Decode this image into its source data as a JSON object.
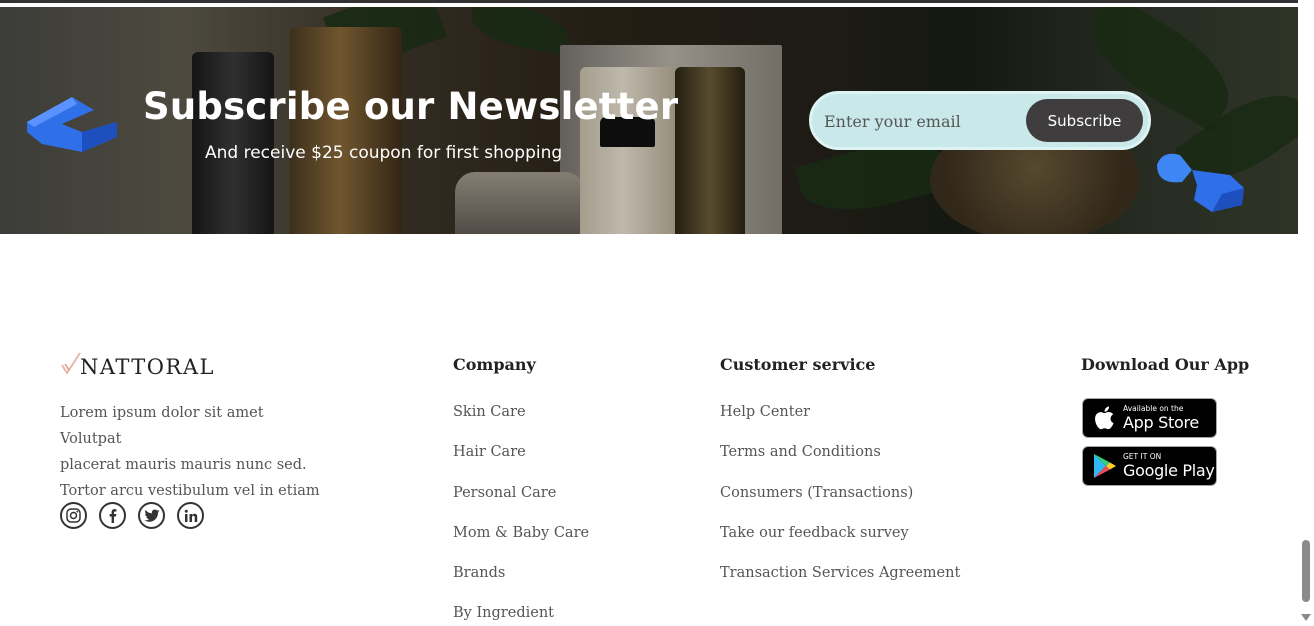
{
  "newsletter": {
    "title": "Subscribe our Newsletter",
    "subtitle": "And receive $25 coupon for first shopping",
    "email_placeholder": "Enter your email",
    "subscribe_label": "Subscribe"
  },
  "brand": {
    "logo_text": "NATTORAL",
    "description_lines": [
      "Lorem ipsum dolor sit amet Volutpat",
      "placerat mauris mauris nunc sed.",
      "Tortor arcu vestibulum vel in etiam"
    ],
    "socials": [
      {
        "icon": "instagram-icon"
      },
      {
        "icon": "facebook-icon"
      },
      {
        "icon": "twitter-icon"
      },
      {
        "icon": "linkedin-icon"
      }
    ]
  },
  "company": {
    "title": "Company",
    "links": [
      "Skin Care",
      "Hair Care",
      "Personal Care",
      "Mom & Baby Care",
      "Brands",
      "By Ingredient"
    ]
  },
  "customer_service": {
    "title": "Customer service",
    "links": [
      "Help Center",
      "Terms and Conditions",
      "Consumers (Transactions)",
      "Take our feedback survey",
      "Transaction Services Agreement"
    ]
  },
  "app": {
    "title": "Download Our App",
    "app_store_small": "Available on the",
    "app_store_big": "App Store",
    "google_play_small": "GET IT ON",
    "google_play_big": "Google Play"
  },
  "colors": {
    "form_bg": "#c9e8e9",
    "subscribe_bg": "#3f3d3e",
    "accent_blue": "#2f6fe8"
  }
}
